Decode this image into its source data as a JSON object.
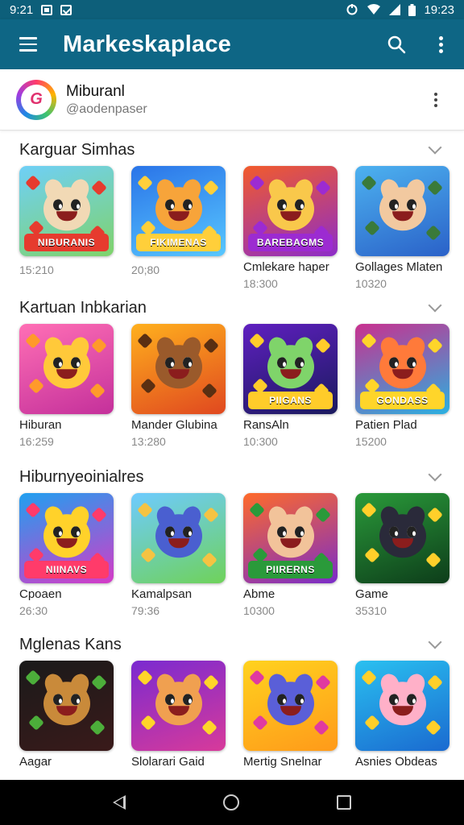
{
  "status_bar": {
    "time_left": "9:21",
    "time_right": "19:23"
  },
  "app_bar": {
    "title": "Markeskaplace"
  },
  "account": {
    "name": "Miburanl",
    "handle": "@aodenpaser"
  },
  "sections": [
    {
      "title": "Karguar Simhas",
      "items": [
        {
          "name": "",
          "count": "15:210",
          "banner": "NIBURANIS",
          "bg": [
            "#6fd0f7",
            "#7fd36a"
          ],
          "face": "#f1d9b5",
          "accent": "#e63b2e"
        },
        {
          "name": "",
          "count": "20;80",
          "banner": "FIKIMENAS",
          "bg": [
            "#2a74e8",
            "#58c7ff"
          ],
          "face": "#f7a43a",
          "accent": "#ffcf3a"
        },
        {
          "name": "Cmlekare haper",
          "count": "18:300",
          "banner": "BAREBAGMS",
          "bg": [
            "#f25b2b",
            "#8c2cc9"
          ],
          "face": "#f9c84b",
          "accent": "#9c2bd1"
        },
        {
          "name": "Gollages Mlaten",
          "count": "10320",
          "banner": "",
          "bg": [
            "#4db2f0",
            "#2a61c8"
          ],
          "face": "#f2c9a0",
          "accent": "#3a7a3a"
        }
      ]
    },
    {
      "title": "Kartuan Inbkarian",
      "items": [
        {
          "name": "Hiburan",
          "count": "16:259",
          "banner": "",
          "bg": [
            "#ff6fb5",
            "#c4309b"
          ],
          "face": "#ffc93a",
          "accent": "#ff9a2a"
        },
        {
          "name": "Mander Glubina",
          "count": "13:280",
          "banner": "",
          "bg": [
            "#ffb01e",
            "#e0481f"
          ],
          "face": "#9a5a2b",
          "accent": "#5a2f12"
        },
        {
          "name": "RansAln",
          "count": "10:300",
          "banner": "PIIGANS",
          "bg": [
            "#5f1fc0",
            "#1a1a5e"
          ],
          "face": "#7fd46a",
          "accent": "#ffcc2a"
        },
        {
          "name": "Patien Plad",
          "count": "15200",
          "banner": "GONDASS",
          "bg": [
            "#c9308f",
            "#2ab0e0"
          ],
          "face": "#ff7a3a",
          "accent": "#ffd52a"
        }
      ]
    },
    {
      "title": "Hiburnyeoinialres",
      "items": [
        {
          "name": "Cpoaen",
          "count": "26:30",
          "banner": "NIINAVS",
          "bg": [
            "#1fa0f0",
            "#d63ac7"
          ],
          "face": "#ffd22a",
          "accent": "#ff3b6a"
        },
        {
          "name": "Kamalpsan",
          "count": "79:36",
          "banner": "",
          "bg": [
            "#6ecbff",
            "#6fd25a"
          ],
          "face": "#4a5fd0",
          "accent": "#f5c342"
        },
        {
          "name": "Abme",
          "count": "10300",
          "banner": "PIIRERNS",
          "bg": [
            "#ff6a2a",
            "#7a2cc9"
          ],
          "face": "#f2c39a",
          "accent": "#2a9a3a"
        },
        {
          "name": "Game",
          "count": "35310",
          "banner": "",
          "bg": [
            "#2a9a3a",
            "#0d3d1a"
          ],
          "face": "#2a2a3a",
          "accent": "#ffcf2a"
        }
      ]
    },
    {
      "title": "Mglenas Kans",
      "items": [
        {
          "name": "Aagar",
          "count": "",
          "banner": "",
          "bg": [
            "#1a1a1a",
            "#3a1a1a"
          ],
          "face": "#c98a3a",
          "accent": "#4cae3a"
        },
        {
          "name": "Slolarari Gaid",
          "count": "",
          "banner": "",
          "bg": [
            "#7a2ad0",
            "#d83a9a"
          ],
          "face": "#f0a050",
          "accent": "#ffd52a"
        },
        {
          "name": "Mertig Snelnar",
          "count": "",
          "banner": "",
          "bg": [
            "#ffd21e",
            "#ff9a1a"
          ],
          "face": "#5a5fd8",
          "accent": "#e03aa0"
        },
        {
          "name": "Asnies Obdeas",
          "count": "",
          "banner": "",
          "bg": [
            "#2ac0f0",
            "#1a6ad0"
          ],
          "face": "#ffb0c8",
          "accent": "#ffcf2a"
        }
      ]
    }
  ]
}
